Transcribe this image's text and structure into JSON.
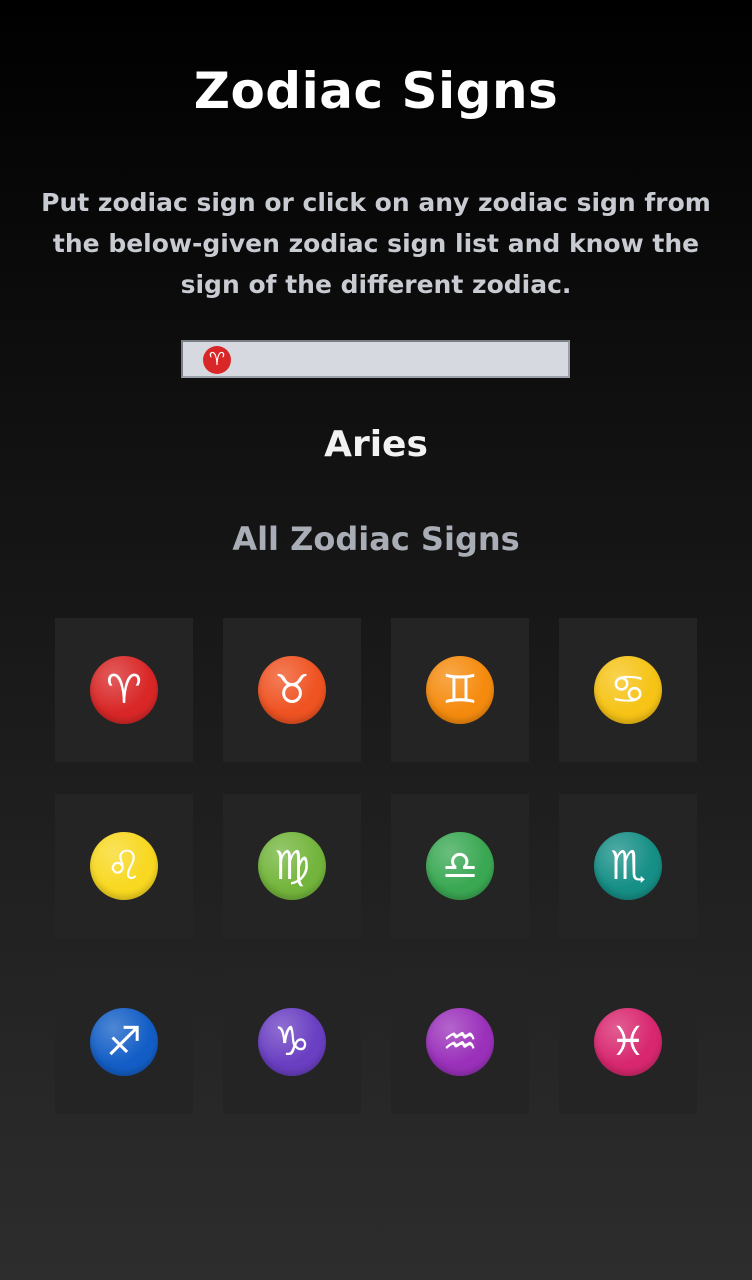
{
  "header": {
    "title": "Zodiac Signs",
    "description": "Put zodiac sign or click on any zodiac sign from the below-given zodiac sign list and know the sign of the different zodiac."
  },
  "input": {
    "value_symbol": "♈",
    "value_color": "#d92727"
  },
  "result": {
    "name": "Aries"
  },
  "list": {
    "title": "All Zodiac Signs",
    "signs": [
      {
        "name": "aries",
        "symbol": "♈",
        "color": "#d92727"
      },
      {
        "name": "taurus",
        "symbol": "♉",
        "color": "#ef5322"
      },
      {
        "name": "gemini",
        "symbol": "♊",
        "color": "#f58b0e"
      },
      {
        "name": "cancer",
        "symbol": "♋",
        "color": "#f6c316"
      },
      {
        "name": "leo",
        "symbol": "♌",
        "color": "#f8d821"
      },
      {
        "name": "virgo",
        "symbol": "♍",
        "color": "#73b53c"
      },
      {
        "name": "libra",
        "symbol": "♎",
        "color": "#3aa853"
      },
      {
        "name": "scorpio",
        "symbol": "♏",
        "color": "#168f86"
      },
      {
        "name": "sagittarius",
        "symbol": "♐",
        "color": "#135ec6"
      },
      {
        "name": "capricorn",
        "symbol": "♑",
        "color": "#6a3fc2"
      },
      {
        "name": "aquarius",
        "symbol": "♒",
        "color": "#9b31bb"
      },
      {
        "name": "pisces",
        "symbol": "♓",
        "color": "#d8276f"
      }
    ]
  }
}
